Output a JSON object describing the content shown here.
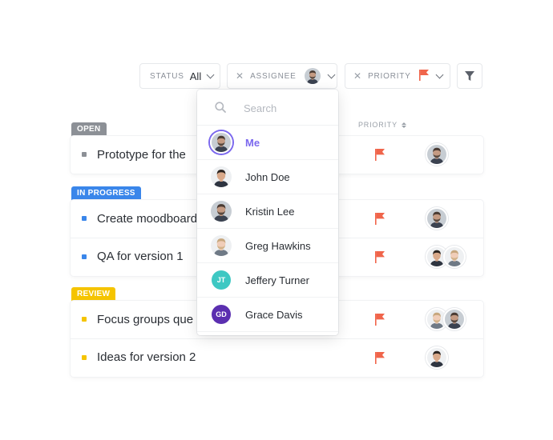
{
  "filters": {
    "status": {
      "label": "STATUS",
      "value": "All"
    },
    "assignee": {
      "label": "ASSIGNEE",
      "clear": "✕"
    },
    "priority": {
      "label": "PRIORITY",
      "clear": "✕",
      "flag_color": "#f0654b"
    }
  },
  "columns": {
    "priority": "PRIORITY"
  },
  "groups": [
    {
      "label": "OPEN",
      "color": "#8c9096",
      "tasks": [
        {
          "name": "Prototype for the",
          "flag_color": "#f0654b",
          "assignees": [
            "man-beard"
          ]
        }
      ]
    },
    {
      "label": "IN PROGRESS",
      "color": "#3a86ea",
      "tasks": [
        {
          "name": "Create moodboard",
          "flag_color": "#f0654b",
          "assignees": [
            "man-beard"
          ]
        },
        {
          "name": "QA for version 1",
          "flag_color": "#f0654b",
          "assignees": [
            "man-dark",
            "man-light"
          ]
        }
      ]
    },
    {
      "label": "REVIEW",
      "color": "#f5c400",
      "tasks": [
        {
          "name": "Focus groups que",
          "flag_color": "#f0654b",
          "assignees": [
            "man-light",
            "man-beard"
          ]
        },
        {
          "name": "Ideas for version 2",
          "flag_color": "#f0654b",
          "assignees": [
            "man-dark"
          ]
        }
      ]
    }
  ],
  "dropdown": {
    "search_placeholder": "Search",
    "users": [
      {
        "name": "Me",
        "avatar": "man-beard",
        "selected": true
      },
      {
        "name": "John Doe",
        "avatar": "man-dark"
      },
      {
        "name": "Kristin Lee",
        "avatar": "man-beard"
      },
      {
        "name": "Greg Hawkins",
        "avatar": "man-light"
      },
      {
        "name": "Jeffery Turner",
        "initials": "JT",
        "color": "#3ec8c3"
      },
      {
        "name": "Grace Davis",
        "initials": "GD",
        "color": "#5b2fb0"
      }
    ]
  }
}
